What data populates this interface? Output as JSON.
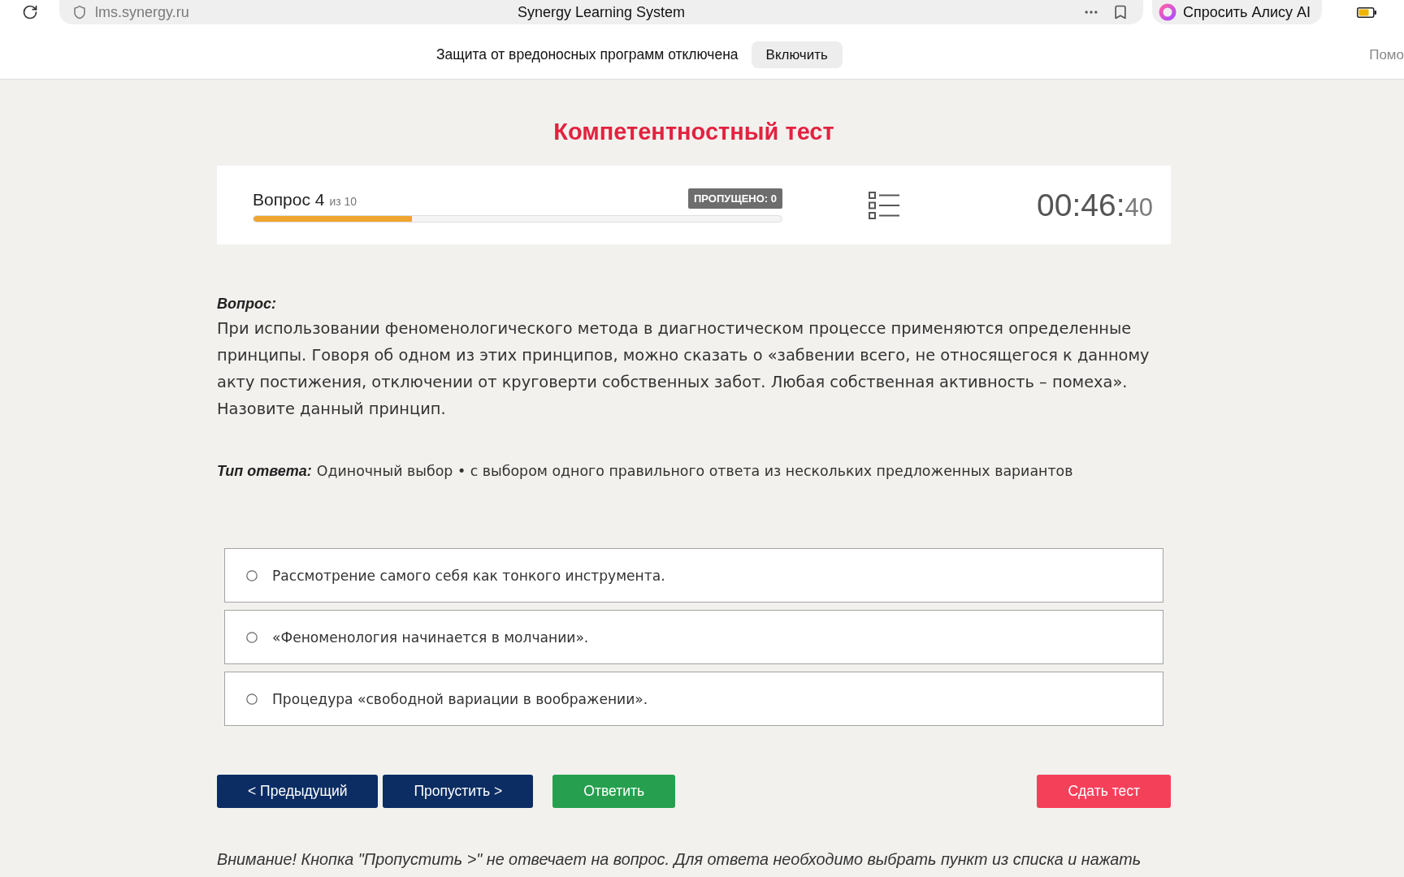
{
  "browser": {
    "url": "lms.synergy.ru",
    "title": "Synergy Learning System",
    "assistant_button": "Спросить Алису AI"
  },
  "notice_bar": {
    "message": "Защита от вредоносных программ отключена",
    "button": "Включить",
    "edge_text": "Помо"
  },
  "page_title": "Компетентностный тест",
  "progress": {
    "label": "Вопрос 4",
    "total": "из 10",
    "level": 0.3,
    "skipped_badge": "ПРОПУЩЕНО: 0",
    "timer_main": "00:46:",
    "timer_seconds": "40"
  },
  "question": {
    "heading": "Вопрос:",
    "text": "При использовании феноменологического метода в диагностическом процессе применяются определенные принципы. Говоря об одном из этих принципов, можно сказать о «забвении всего, не относящегося к данному акту постижения, отключении от круговерти собственных забот. Любая собственная активность – помеха». Назовите данный принцип.",
    "answer_type_label": "Тип ответа:",
    "answer_type": "Одиночный выбор • с выбором одного правильного ответа из нескольких предложенных вариантов"
  },
  "options": [
    {
      "text": "Рассмотрение самого себя как тонкого инструмента.",
      "selected": false
    },
    {
      "text": "«Феноменология начинается в молчании».",
      "selected": false
    },
    {
      "text": "Процедура «свободной вариации в воображении».",
      "selected": false
    }
  ],
  "buttons": [
    {
      "label": "< Предыдущий",
      "kind": "nav"
    },
    {
      "label": "Пропустить >",
      "kind": "nav"
    },
    {
      "label": "Ответить",
      "kind": "answer"
    },
    {
      "label": "Сдать тест",
      "kind": "submit"
    }
  ],
  "warning": "Внимание! Кнопка \"Пропустить >\" не отвечает на вопрос. Для ответа необходимо выбрать пункт из списка и нажать"
}
